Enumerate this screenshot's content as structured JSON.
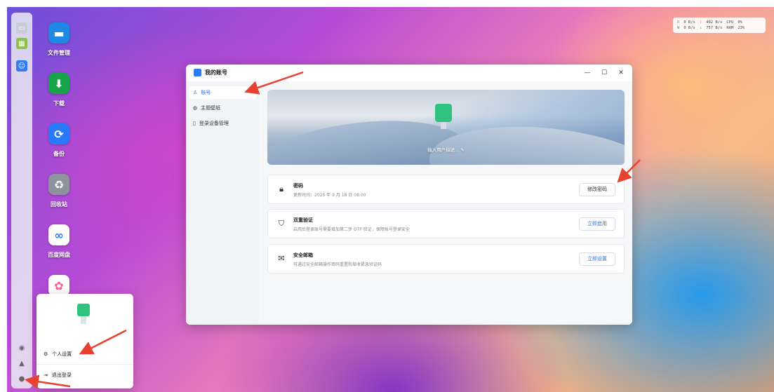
{
  "dock": {
    "icons": [
      "monitor-icon",
      "apps-grid-icon",
      "user-account-icon",
      "settings-circle-icon",
      "bell-icon",
      "user-icon"
    ]
  },
  "desktop": {
    "apps": [
      {
        "label": "文件管理",
        "icon": "folder-icon",
        "color": "#1e88e5"
      },
      {
        "label": "下载",
        "icon": "download-icon",
        "color": "#16a34a"
      },
      {
        "label": "备份",
        "icon": "backup-icon",
        "color": "#2979ff"
      },
      {
        "label": "回收站",
        "icon": "recycle-bin-icon",
        "color": "#9aa0a6"
      },
      {
        "label": "百度网盘",
        "icon": "baidu-netdisk-icon",
        "color": "#ffffff"
      },
      {
        "label": "",
        "icon": "photos-icon",
        "color": "#ffffff"
      }
    ]
  },
  "stats": {
    "r_label": "R",
    "r_in": "0 B/s",
    "r_out": "402 B/s",
    "cpu_label": "CPU",
    "cpu": "0%",
    "w_label": "W",
    "w_in": "0 B/s",
    "w_out": "757 B/s",
    "ram_label": "RAM",
    "ram": "23%"
  },
  "window": {
    "title": "我的账号",
    "controls": {
      "minimize": "—",
      "maximize": "☐",
      "close": "✕"
    },
    "sidebar": [
      {
        "label": "账号",
        "icon": "user-icon"
      },
      {
        "label": "主题壁纸",
        "icon": "palette-icon"
      },
      {
        "label": "登录设备管理",
        "icon": "device-icon"
      }
    ],
    "banner": {
      "description": "输入用户描述..."
    },
    "cards": [
      {
        "title": "密码",
        "subtitle": "更新时间：2025 年 9 月 18 日 08:00",
        "button": "修改密码",
        "icon": "lock-icon"
      },
      {
        "title": "双重验证",
        "subtitle": "启用后登录账号需要增加第二步 OTP 验证，保障账号登录安全",
        "button": "立即启用",
        "icon": "shield-check-icon"
      },
      {
        "title": "安全邮箱",
        "subtitle": "可通过安全邮箱操作密码重置和接收紧急验证码",
        "button": "立即设置",
        "icon": "mail-icon"
      }
    ]
  },
  "popup": {
    "items": [
      {
        "label": "个人设置",
        "icon": "user-settings-icon"
      },
      {
        "label": "退出登录",
        "icon": "logout-icon"
      }
    ]
  },
  "colors": {
    "accent": "#2a6fe8",
    "arrow": "#e8412f"
  }
}
